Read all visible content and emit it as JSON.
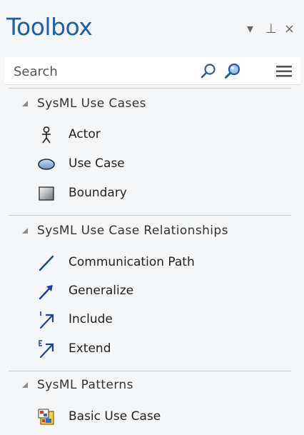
{
  "window": {
    "title": "Toolbox",
    "controls": {
      "dropdown": "▾",
      "pin": "⊥",
      "close": "×"
    }
  },
  "search": {
    "placeholder": "Search",
    "value": ""
  },
  "groups": [
    {
      "label": "SysML Use Cases",
      "items": [
        {
          "label": "Actor",
          "icon": "actor-icon"
        },
        {
          "label": "Use Case",
          "icon": "use-case-icon"
        },
        {
          "label": "Boundary",
          "icon": "boundary-icon"
        }
      ]
    },
    {
      "label": "SysML Use Case Relationships",
      "items": [
        {
          "label": "Communication Path",
          "icon": "communication-path-icon"
        },
        {
          "label": "Generalize",
          "icon": "generalize-icon"
        },
        {
          "label": "Include",
          "icon": "include-icon"
        },
        {
          "label": "Extend",
          "icon": "extend-icon"
        }
      ]
    },
    {
      "label": "SysML Patterns",
      "items": [
        {
          "label": "Basic Use Case",
          "icon": "basic-use-case-icon"
        }
      ]
    }
  ],
  "colors": {
    "title": "#1f5fa8",
    "background": "#f5f6f7",
    "link_blue": "#1c3f9e"
  }
}
